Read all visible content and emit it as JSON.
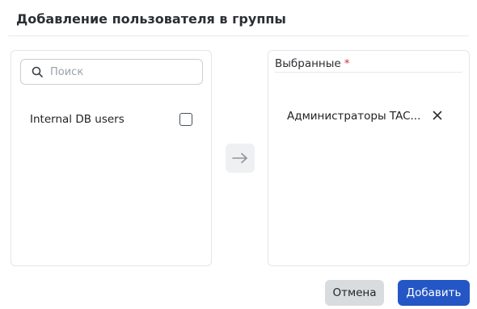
{
  "dialog": {
    "title": "Добавление пользователя в группы"
  },
  "left_panel": {
    "search": {
      "placeholder": "Поиск",
      "value": ""
    },
    "groups": [
      {
        "label": "Internal DB users",
        "checked": false
      }
    ]
  },
  "transfer": {
    "icon": "arrow-right-icon"
  },
  "right_panel": {
    "label": "Выбранные",
    "required_mark": "*",
    "selected": [
      {
        "label": "Администраторы TAC..."
      }
    ]
  },
  "footer": {
    "cancel_label": "Отмена",
    "add_label": "Добавить"
  },
  "colors": {
    "primary": "#2457c5",
    "required": "#d92d3a",
    "secondary_button": "#d9dcdf"
  }
}
